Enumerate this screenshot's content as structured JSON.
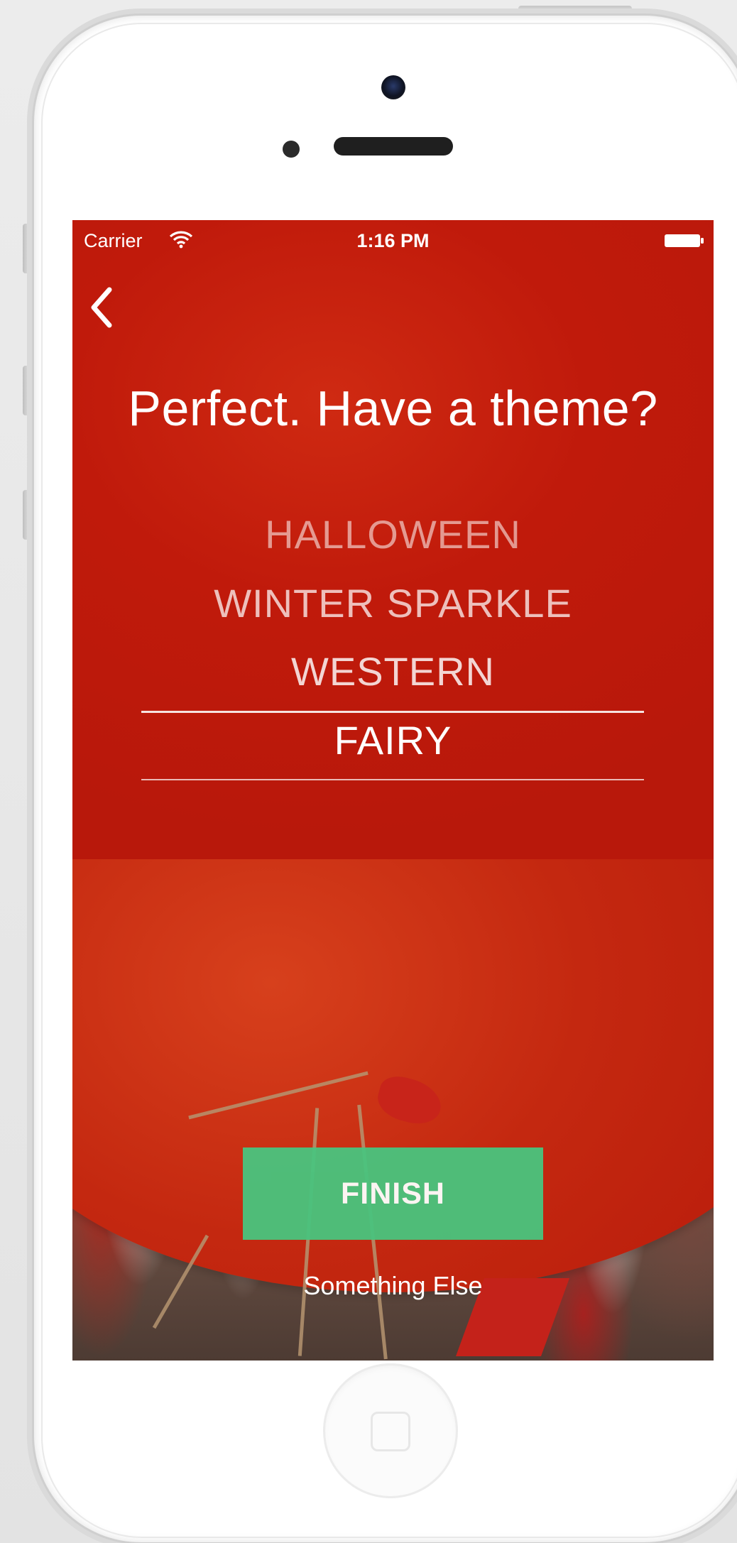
{
  "status_bar": {
    "carrier": "Carrier",
    "time": "1:16 PM",
    "wifi_icon": "wifi-icon",
    "battery_icon": "battery-icon"
  },
  "nav": {
    "back_icon": "chevron-left-icon"
  },
  "title": "Perfect. Have a theme?",
  "theme_picker": {
    "items": [
      "HALLOWEEN",
      "WINTER SPARKLE",
      "WESTERN",
      "FAIRY"
    ],
    "selected": "FAIRY"
  },
  "finish_button": {
    "label": "FINISH",
    "color": "#49c47e"
  },
  "alt_link": "Something Else",
  "colors": {
    "background_red": "#c01a0b",
    "text": "#ffffff"
  }
}
